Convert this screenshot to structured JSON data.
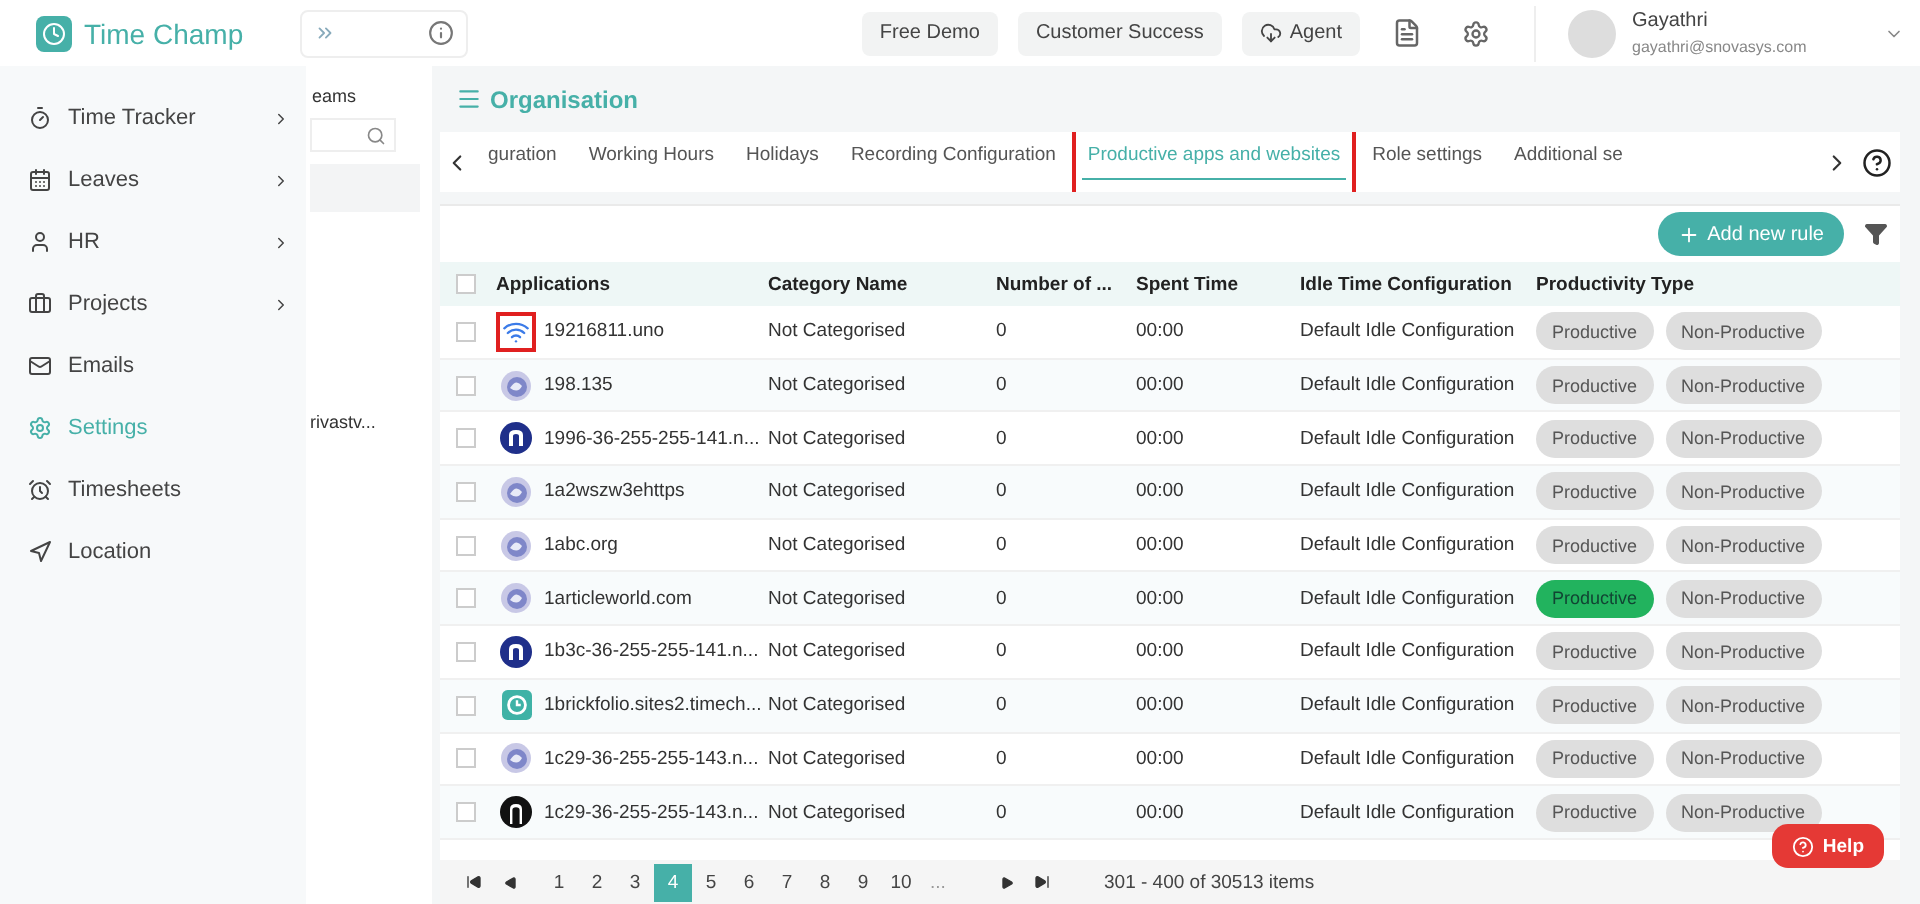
{
  "brand": {
    "name": "Time Champ"
  },
  "top_buttons": [
    {
      "label": "Free Demo",
      "kind": "plain"
    },
    {
      "label": "Customer Success",
      "kind": "plain"
    },
    {
      "label": "Agent",
      "kind": "agent"
    }
  ],
  "user": {
    "name": "Gayathri",
    "email": "gayathri@snovasys.com"
  },
  "sidebar": {
    "items": [
      {
        "label": "Time Tracker",
        "has_children": true,
        "selected": false
      },
      {
        "label": "Leaves",
        "has_children": true,
        "selected": false
      },
      {
        "label": "HR",
        "has_children": true,
        "selected": false
      },
      {
        "label": "Projects",
        "has_children": true,
        "selected": false
      },
      {
        "label": "Emails",
        "has_children": false,
        "selected": false
      },
      {
        "label": "Settings",
        "has_children": false,
        "selected": true
      },
      {
        "label": "Timesheets",
        "has_children": false,
        "selected": false
      },
      {
        "label": "Location",
        "has_children": false,
        "selected": false
      }
    ]
  },
  "side_panel": {
    "title": "eams",
    "item": "rivastv..."
  },
  "page_title": "Organisation",
  "tabs": [
    {
      "label": "guration",
      "selected": false,
      "highlighted": false
    },
    {
      "label": "Working Hours",
      "selected": false,
      "highlighted": false
    },
    {
      "label": "Holidays",
      "selected": false,
      "highlighted": false
    },
    {
      "label": "Recording Configuration",
      "selected": false,
      "highlighted": false
    },
    {
      "label": "Productive apps and websites",
      "selected": true,
      "highlighted": true
    },
    {
      "label": "Role settings",
      "selected": false,
      "highlighted": false
    },
    {
      "label": "Additional se",
      "selected": false,
      "highlighted": false
    }
  ],
  "add_button": {
    "label": "Add new rule"
  },
  "table": {
    "header_checked": false,
    "columns": [
      "Applications",
      "Category Name",
      "Number of ...",
      "Spent Time",
      "Idle Time Configuration",
      "Productivity Type"
    ],
    "rows": [
      {
        "kind": "wifi",
        "icon_highlighted": true,
        "checked": false,
        "app": "19216811.uno",
        "category": "Not Categorised",
        "number": "0",
        "spent": "00:00",
        "idle": "Default Idle Configuration",
        "types": [
          {
            "label": "Productive",
            "selected": false
          },
          {
            "label": "Non-Productive",
            "selected": false
          }
        ]
      },
      {
        "kind": "globe",
        "icon_highlighted": false,
        "checked": false,
        "app": "198.135",
        "category": "Not Categorised",
        "number": "0",
        "spent": "00:00",
        "idle": "Default Idle Configuration",
        "types": [
          {
            "label": "Productive",
            "selected": false
          },
          {
            "label": "Non-Productive",
            "selected": false
          }
        ]
      },
      {
        "kind": "n-logo",
        "icon_highlighted": false,
        "checked": false,
        "app": "1996-36-255-255-141.n...",
        "category": "Not Categorised",
        "number": "0",
        "spent": "00:00",
        "idle": "Default Idle Configuration",
        "types": [
          {
            "label": "Productive",
            "selected": false
          },
          {
            "label": "Non-Productive",
            "selected": false
          }
        ]
      },
      {
        "kind": "globe",
        "icon_highlighted": false,
        "checked": false,
        "app": "1a2wszw3ehttps",
        "category": "Not Categorised",
        "number": "0",
        "spent": "00:00",
        "idle": "Default Idle Configuration",
        "types": [
          {
            "label": "Productive",
            "selected": false
          },
          {
            "label": "Non-Productive",
            "selected": false
          }
        ]
      },
      {
        "kind": "globe",
        "icon_highlighted": false,
        "checked": false,
        "app": "1abc.org",
        "category": "Not Categorised",
        "number": "0",
        "spent": "00:00",
        "idle": "Default Idle Configuration",
        "types": [
          {
            "label": "Productive",
            "selected": false
          },
          {
            "label": "Non-Productive",
            "selected": false
          }
        ]
      },
      {
        "kind": "globe",
        "icon_highlighted": false,
        "checked": false,
        "app": "1articleworld.com",
        "category": "Not Categorised",
        "number": "0",
        "spent": "00:00",
        "idle": "Default Idle Configuration",
        "types": [
          {
            "label": "Productive",
            "selected": true
          },
          {
            "label": "Non-Productive",
            "selected": false
          }
        ]
      },
      {
        "kind": "n-logo",
        "icon_highlighted": false,
        "checked": false,
        "app": "1b3c-36-255-255-141.n...",
        "category": "Not Categorised",
        "number": "0",
        "spent": "00:00",
        "idle": "Default Idle Configuration",
        "types": [
          {
            "label": "Productive",
            "selected": false
          },
          {
            "label": "Non-Productive",
            "selected": false
          }
        ]
      },
      {
        "kind": "clock-logo",
        "icon_highlighted": false,
        "checked": false,
        "app": "1brickfolio.sites2.timech...",
        "category": "Not Categorised",
        "number": "0",
        "spent": "00:00",
        "idle": "Default Idle Configuration",
        "types": [
          {
            "label": "Productive",
            "selected": false
          },
          {
            "label": "Non-Productive",
            "selected": false
          }
        ]
      },
      {
        "kind": "globe",
        "icon_highlighted": false,
        "checked": false,
        "app": "1c29-36-255-255-143.n...",
        "category": "Not Categorised",
        "number": "0",
        "spent": "00:00",
        "idle": "Default Idle Configuration",
        "types": [
          {
            "label": "Productive",
            "selected": false
          },
          {
            "label": "Non-Productive",
            "selected": false
          }
        ]
      },
      {
        "kind": "arch-logo",
        "icon_highlighted": false,
        "checked": false,
        "app": "1c29-36-255-255-143.n...",
        "category": "Not Categorised",
        "number": "0",
        "spent": "00:00",
        "idle": "Default Idle Configuration",
        "types": [
          {
            "label": "Productive",
            "selected": false
          },
          {
            "label": "Non-Productive",
            "selected": false
          }
        ]
      }
    ]
  },
  "pagination": {
    "pages": [
      {
        "label": "1",
        "selected": false
      },
      {
        "label": "2",
        "selected": false
      },
      {
        "label": "3",
        "selected": false
      },
      {
        "label": "4",
        "selected": true
      },
      {
        "label": "5",
        "selected": false
      },
      {
        "label": "6",
        "selected": false
      },
      {
        "label": "7",
        "selected": false
      },
      {
        "label": "8",
        "selected": false
      },
      {
        "label": "9",
        "selected": false
      },
      {
        "label": "10",
        "selected": false
      }
    ],
    "more": "...",
    "summary": "301 - 400 of 30513 items"
  },
  "help_button": {
    "label": "Help"
  }
}
